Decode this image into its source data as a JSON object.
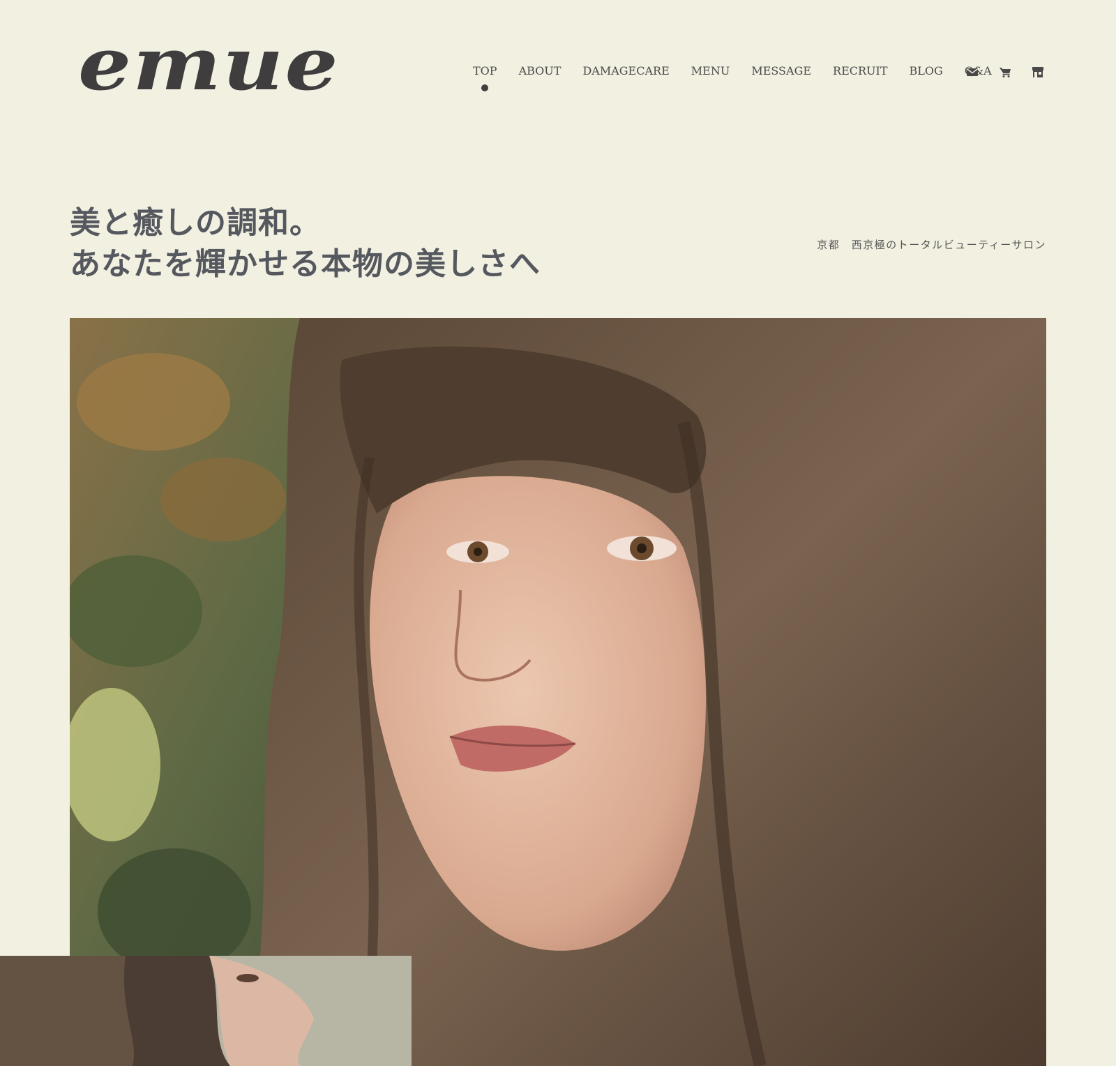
{
  "brand": {
    "logo_text": "emue"
  },
  "nav": {
    "items": [
      {
        "label": "TOP",
        "active": true
      },
      {
        "label": "ABOUT",
        "active": false
      },
      {
        "label": "DAMAGECARE",
        "active": false
      },
      {
        "label": "MENU",
        "active": false
      },
      {
        "label": "MESSAGE",
        "active": false
      },
      {
        "label": "RECRUIT",
        "active": false
      },
      {
        "label": "BLOG",
        "active": false
      },
      {
        "label": "Q&A",
        "active": false
      }
    ],
    "icons": [
      "envelope-icon",
      "cart-icon",
      "store-icon"
    ]
  },
  "hero": {
    "headline_line1": "美と癒しの調和。",
    "headline_line2": "あなたを輝かせる本物の美しさへ",
    "tagline": "京都　西京極のトータルビューティーサロン"
  },
  "colors": {
    "background": "#f2f0e1",
    "text": "#4a4a4a",
    "headline": "#55585e"
  }
}
